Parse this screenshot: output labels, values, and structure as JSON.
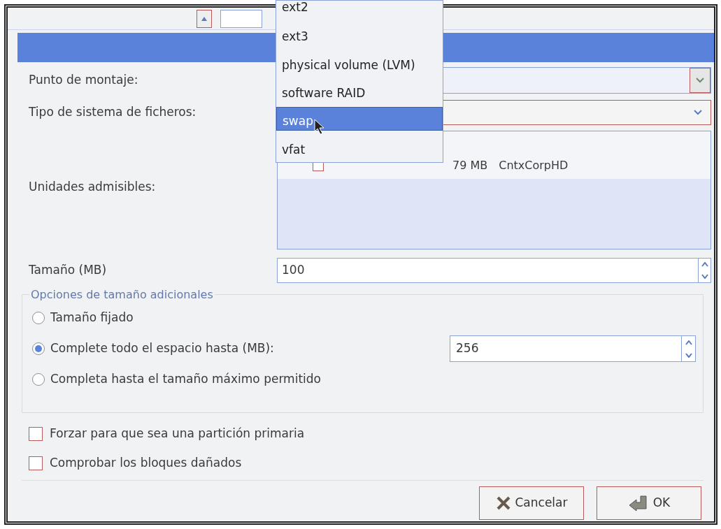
{
  "form": {
    "mount_point": {
      "label": "Punto de montaje:"
    },
    "fs_type": {
      "label": "Tipo de sistema de ficheros:"
    },
    "drives": {
      "label": "Unidades admisibles:",
      "rows": [
        {
          "checked": false,
          "size": "79 MB",
          "model": "CntxCorpHD"
        }
      ]
    },
    "size": {
      "label": "Tamaño (MB)",
      "value": "100"
    },
    "size_options": {
      "title": "Opciones de tamaño adicionales",
      "options": [
        {
          "label": "Tamaño fijado",
          "selected": false
        },
        {
          "label": "Complete todo el espacio hasta (MB):",
          "selected": true,
          "value": "256"
        },
        {
          "label": "Completa hasta el tamaño máximo permitido",
          "selected": false
        }
      ]
    },
    "checkboxes": [
      {
        "label": "Forzar para que sea una partición primaria",
        "checked": false
      },
      {
        "label": "Comprobar los bloques dañados",
        "checked": false
      }
    ],
    "buttons": [
      {
        "kind": "cancel",
        "label": "Cancelar"
      },
      {
        "kind": "ok",
        "label": "OK"
      }
    ]
  },
  "dropdown": {
    "items": [
      {
        "label": "ext2",
        "selected": false
      },
      {
        "label": "ext3",
        "selected": false
      },
      {
        "label": "physical volume (LVM)",
        "selected": false
      },
      {
        "label": "software RAID",
        "selected": false
      },
      {
        "label": "swap",
        "selected": true
      },
      {
        "label": "vfat",
        "selected": false
      }
    ]
  }
}
